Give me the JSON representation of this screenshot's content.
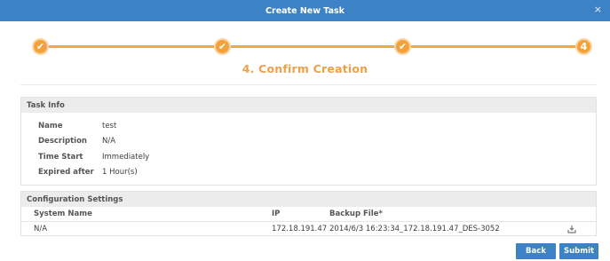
{
  "dialog": {
    "title": "Create New Task",
    "close_label": "×"
  },
  "stepper": {
    "steps": [
      {
        "state": "done",
        "glyph": "✔"
      },
      {
        "state": "done",
        "glyph": "✔"
      },
      {
        "state": "done",
        "glyph": "✔"
      },
      {
        "state": "current",
        "glyph": "4"
      }
    ],
    "current_title": "4. Confirm Creation",
    "accent_color": "#f2a238"
  },
  "task_info": {
    "heading": "Task Info",
    "rows": [
      {
        "label": "Name",
        "value": "test"
      },
      {
        "label": "Description",
        "value": "N/A"
      },
      {
        "label": "Time Start",
        "value": "Immediately"
      },
      {
        "label": "Expired after",
        "value": "1 Hour(s)"
      }
    ]
  },
  "config": {
    "heading": "Configuration Settings",
    "columns": [
      "System Name",
      "IP",
      "Backup File*"
    ],
    "rows": [
      {
        "system_name": "N/A",
        "ip": "172.18.191.47",
        "backup_file": "2014/6/3 16:23:34_172.18.191.47_DES-3052",
        "action_icon": "download-icon"
      }
    ]
  },
  "buttons": {
    "back": "Back",
    "submit": "Submit"
  },
  "colors": {
    "header_blue": "#3c82c5",
    "step_orange": "#f2a238"
  }
}
